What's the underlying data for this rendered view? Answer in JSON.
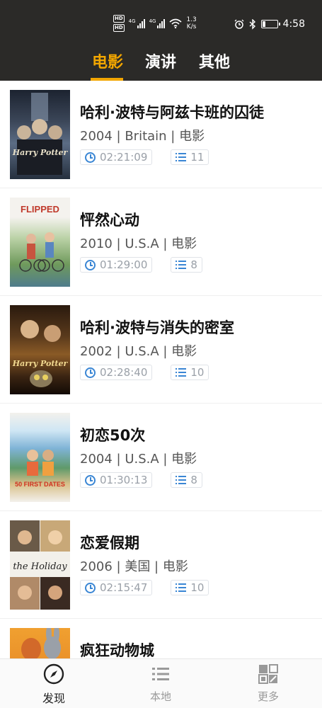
{
  "status_bar": {
    "hd1": "HD",
    "hd2": "HD",
    "net1": "4G",
    "net2": "4G",
    "speed_value": "1.3",
    "speed_unit": "K/s",
    "time": "4:58",
    "icons": [
      "alarm-icon",
      "bluetooth-icon",
      "battery-icon",
      "wifi-icon",
      "signal-icon"
    ]
  },
  "tabs": [
    {
      "label": "电影",
      "active": true
    },
    {
      "label": "演讲",
      "active": false
    },
    {
      "label": "其他",
      "active": false
    }
  ],
  "movies": [
    {
      "title": "哈利·波特与阿兹卡班的囚徒",
      "meta": "2004 | Britain | 电影",
      "duration": "02:21:09",
      "episodes": "11"
    },
    {
      "title": "怦然心动",
      "meta": "2010 | U.S.A | 电影",
      "duration": "01:29:00",
      "episodes": "8"
    },
    {
      "title": "哈利·波特与消失的密室",
      "meta": "2002 | U.S.A | 电影",
      "duration": "02:28:40",
      "episodes": "10"
    },
    {
      "title": "初恋50次",
      "meta": "2004 | U.S.A | 电影",
      "duration": "01:30:13",
      "episodes": "8"
    },
    {
      "title": "恋爱假期",
      "meta": "2006 | 美国 | 电影",
      "duration": "02:15:47",
      "episodes": "10"
    },
    {
      "title": "疯狂动物城",
      "meta": "",
      "duration": "",
      "episodes": ""
    }
  ],
  "posters": {
    "p1": "Harry Potter",
    "p2": "FLIPPED",
    "p3": "Harry Potter",
    "p4": "50 FIRST DATES",
    "p5": "the Holiday"
  },
  "bottom_nav": [
    {
      "label": "发现",
      "active": true
    },
    {
      "label": "本地",
      "active": false
    },
    {
      "label": "更多",
      "active": false
    }
  ],
  "colors": {
    "header_bg": "#2b2a28",
    "accent": "#f2a600",
    "icon_blue": "#3a86d4"
  }
}
